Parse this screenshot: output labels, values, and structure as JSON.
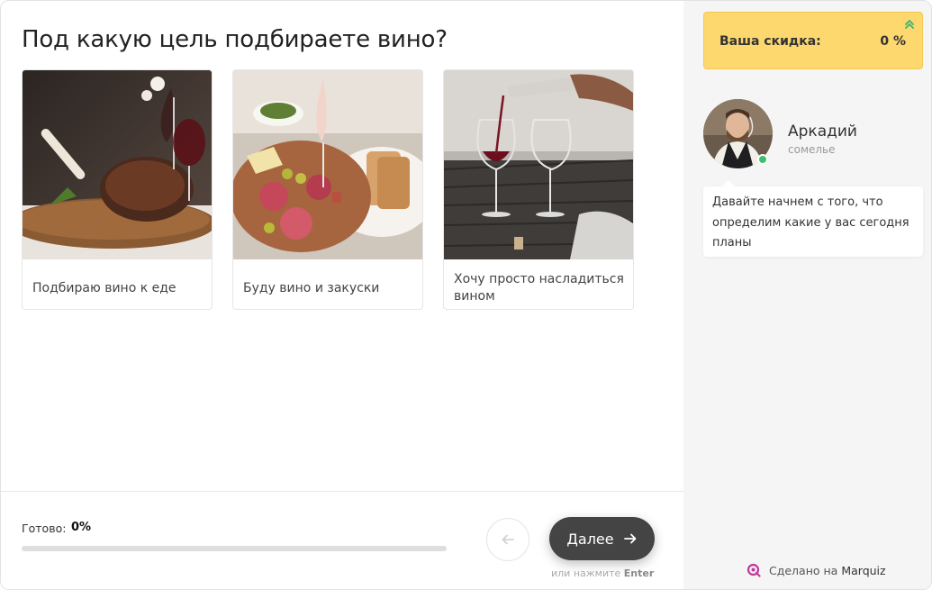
{
  "quiz": {
    "question": "Под какую цель подбираете вино?",
    "options": [
      {
        "label": "Подбираю вино к еде",
        "image": "steak-with-wine"
      },
      {
        "label": "Буду вино и закуски",
        "image": "charcuterie-with-wine"
      },
      {
        "label": "Хочу просто насладиться вином",
        "image": "pouring-wine-glasses"
      }
    ]
  },
  "footer": {
    "progress_label": "Готово:",
    "progress_value": "0%",
    "progress_fraction": 0,
    "next_label": "Далее",
    "hint_prefix": "или нажмите",
    "hint_key": "Enter"
  },
  "sidebar": {
    "discount_label": "Ваша скидка:",
    "discount_value": "0 %",
    "consultant_name": "Аркадий",
    "consultant_role": "сомелье",
    "message": "Давайте начнем с того, что определим какие у вас сегодня планы",
    "made_by_prefix": "Сделано на",
    "made_by_brand": "Marquiz"
  },
  "colors": {
    "accent_dark": "#444444",
    "discount_bg": "#fcd86f",
    "online": "#3cc16b",
    "sidebar_bg": "#f5f5f5",
    "discount_arrow": "#3cb371",
    "marquiz_pink": "#c0399b"
  },
  "icons": [
    "arrow-left-icon",
    "arrow-right-icon",
    "chevron-double-up-icon",
    "marquiz-logo-icon",
    "online-status-icon"
  ]
}
